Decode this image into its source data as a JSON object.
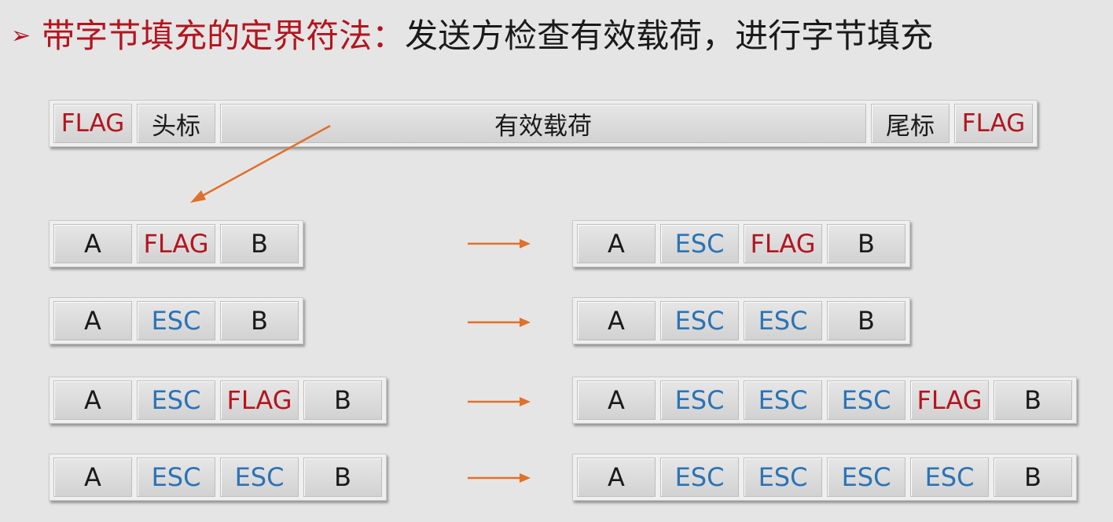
{
  "title": {
    "bullet": "➢",
    "red_part": "带字节填充的定界符法：",
    "black_part": "发送方检查有效载荷，进行字节填充"
  },
  "frame": {
    "flag_left": "FLAG",
    "header": "头标",
    "payload": "有效载荷",
    "trailer": "尾标",
    "flag_right": "FLAG"
  },
  "rows": [
    {
      "input": [
        "A",
        "FLAG",
        "B"
      ],
      "output": [
        "A",
        "ESC",
        "FLAG",
        "B"
      ]
    },
    {
      "input": [
        "A",
        "ESC",
        "B"
      ],
      "output": [
        "A",
        "ESC",
        "ESC",
        "B"
      ]
    },
    {
      "input": [
        "A",
        "ESC",
        "FLAG",
        "B"
      ],
      "output": [
        "A",
        "ESC",
        "ESC",
        "ESC",
        "FLAG",
        "B"
      ]
    },
    {
      "input": [
        "A",
        "ESC",
        "ESC",
        "B"
      ],
      "output": [
        "A",
        "ESC",
        "ESC",
        "ESC",
        "ESC",
        "B"
      ]
    }
  ],
  "colors": {
    "flag": "#b3151f",
    "esc": "#2b73b6",
    "arrow": "#e0702a"
  }
}
